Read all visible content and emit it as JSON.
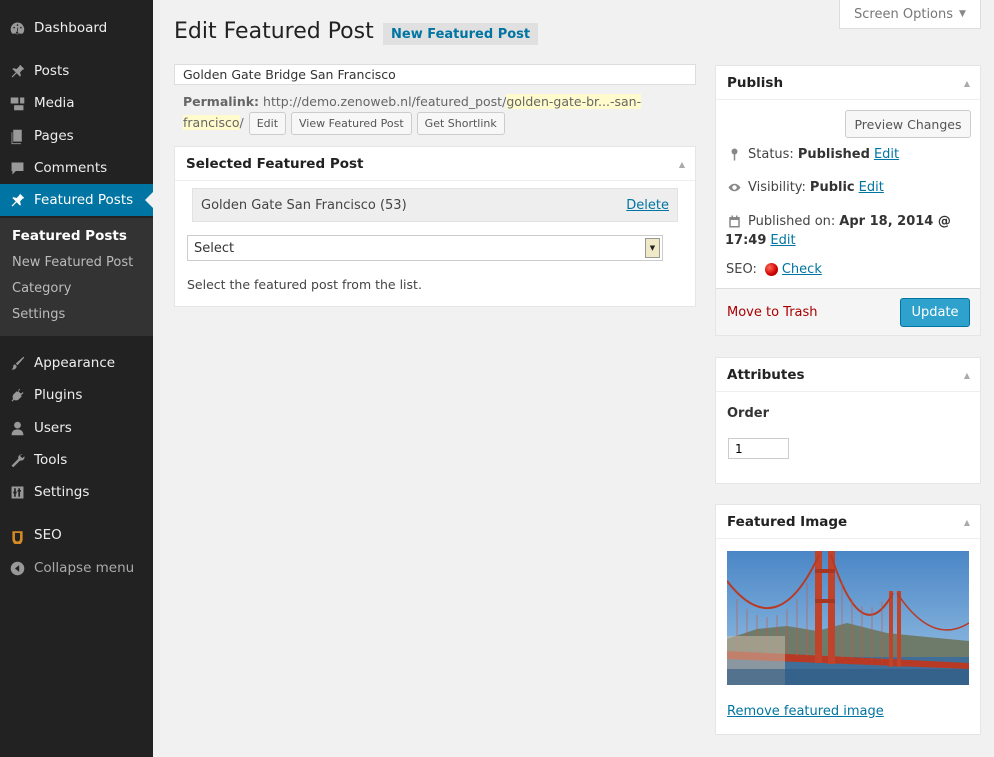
{
  "sidebar": {
    "items": [
      {
        "label": "Dashboard",
        "icon": "dashboard-icon"
      },
      {
        "label": "Posts",
        "icon": "pin-icon"
      },
      {
        "label": "Media",
        "icon": "media-icon"
      },
      {
        "label": "Pages",
        "icon": "pages-icon"
      },
      {
        "label": "Comments",
        "icon": "comment-icon"
      },
      {
        "label": "Featured Posts",
        "icon": "pin-icon"
      },
      {
        "label": "Appearance",
        "icon": "brush-icon"
      },
      {
        "label": "Plugins",
        "icon": "plugin-icon"
      },
      {
        "label": "Users",
        "icon": "user-icon"
      },
      {
        "label": "Tools",
        "icon": "wrench-icon"
      },
      {
        "label": "Settings",
        "icon": "sliders-icon"
      },
      {
        "label": "SEO",
        "icon": "seo-icon"
      },
      {
        "label": "Collapse menu",
        "icon": "collapse-icon"
      }
    ],
    "submenu": [
      "Featured Posts",
      "New Featured Post",
      "Category",
      "Settings"
    ]
  },
  "screen_options": "Screen Options",
  "header": {
    "title": "Edit Featured Post",
    "add_new": "New Featured Post"
  },
  "post": {
    "title": "Golden Gate Bridge San Francisco",
    "permalink_label": "Permalink:",
    "permalink_base": "http://demo.zenoweb.nl/featured_post/",
    "permalink_slug_1": "golden-gate-br...-san-",
    "permalink_slug_2": "francisco",
    "permalink_trail": "/",
    "buttons": {
      "edit": "Edit",
      "view": "View Featured Post",
      "shortlink": "Get Shortlink"
    }
  },
  "selected_box": {
    "title": "Selected Featured Post",
    "item": "Golden Gate San Francisco (53)",
    "delete": "Delete",
    "select_value": "Select",
    "help": "Select the featured post from the list."
  },
  "publish": {
    "title": "Publish",
    "preview": "Preview Changes",
    "status_label": "Status:",
    "status_value": "Published",
    "visibility_label": "Visibility:",
    "visibility_value": "Public",
    "published_label": "Published on:",
    "published_value_1": "Apr 18, 2014 @",
    "published_value_2": "17:49",
    "edit": "Edit",
    "seo_label": "SEO:",
    "seo_check": "Check",
    "trash": "Move to Trash",
    "update": "Update"
  },
  "attributes": {
    "title": "Attributes",
    "order_label": "Order",
    "order_value": "1"
  },
  "featured_image": {
    "title": "Featured Image",
    "remove": "Remove featured image"
  },
  "colors": {
    "sidebar_bg": "#222222",
    "accent": "#0074a2",
    "update_button": "#2ea2cc",
    "trash": "#aa0000"
  }
}
